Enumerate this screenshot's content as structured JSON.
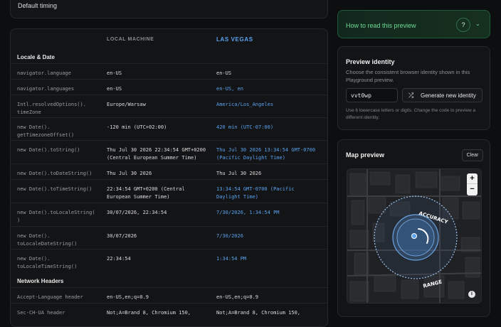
{
  "top_card": {
    "label": "Default timing"
  },
  "table": {
    "col_local": "LOCAL MACHINE",
    "col_remote": "LAS VEGAS",
    "sections": [
      {
        "title": "Locale & Date"
      },
      {
        "title": "Network Headers"
      }
    ],
    "rows": [
      {
        "key": "navigator.language",
        "local": "en-US",
        "remote": "en-US",
        "remote_highlight": false
      },
      {
        "key": "navigator.languages",
        "local": "en-US",
        "remote": "en-US, en",
        "remote_highlight": true
      },
      {
        "key": "Intl.resolvedOptions().\ntimeZone",
        "local": "Europe/Warsaw",
        "remote": "America/Los_Angeles",
        "remote_highlight": true
      },
      {
        "key": "new Date().\ngetTimezoneOffset()",
        "local": "-120 min (UTC+02:00)",
        "remote": "420 min (UTC-07:00)",
        "remote_highlight": true
      },
      {
        "key": "new Date().toString()",
        "local": "Thu Jul 30 2026 22:34:54 GMT+0200\n(Central European Summer Time)",
        "remote": "Thu Jul 30 2026 13:34:54 GMT-0700\n(Pacific Daylight Time)",
        "remote_highlight": true
      },
      {
        "key": "new Date().toDateString()",
        "local": "Thu Jul 30 2026",
        "remote": "Thu Jul 30 2026",
        "remote_highlight": false
      },
      {
        "key": "new Date().toTimeString()",
        "local": "22:34:54 GMT+0200 (Central\nEuropean Summer Time)",
        "remote": "13:34:54 GMT-0700 (Pacific\nDaylight Time)",
        "remote_highlight": true
      },
      {
        "key": "new Date().toLocaleString(\n)",
        "local": "30/07/2026, 22:34:54",
        "remote": "7/30/2026, 1:34:54 PM",
        "remote_highlight": true
      },
      {
        "key": "new Date().\ntoLocaleDateString()",
        "local": "30/07/2026",
        "remote": "7/30/2026",
        "remote_highlight": true
      },
      {
        "key": "new Date().\ntoLocaleTimeString()",
        "local": "22:34:54",
        "remote": "1:34:54 PM",
        "remote_highlight": true
      },
      {
        "key": "Accept-Language header",
        "local": "en-US,en;q=0.9",
        "remote": "en-US,en;q=0.9",
        "remote_highlight": false
      },
      {
        "key": "Sec-CH-UA header",
        "local": "Not;A=Brand 8, Chromium 150,",
        "remote": "Not;A=Brand 8, Chromium 150,",
        "remote_highlight": false
      }
    ]
  },
  "how_to": {
    "label": "How to read this preview",
    "help_icon": "question-icon",
    "chevron_icon": "chevron-down-icon"
  },
  "identity": {
    "title": "Preview identity",
    "description": "Choose the consistent browser identity shown in this Playground preview.",
    "code_value": "vvt0wp",
    "generate_label": "Generate new identity",
    "generate_icon": "shuffle-icon",
    "hint": "Use 6 lowercase letters or digits. Change the code to preview a different identity."
  },
  "map": {
    "title": "Map preview",
    "clear_label": "Clear",
    "zoom_in": "+",
    "zoom_out": "−",
    "accuracy_label": "ACCURACY",
    "range_label": "RANGE",
    "info_icon": "info-icon",
    "colors": {
      "accent": "#5aa2f0",
      "green": "#6fdc9a"
    }
  }
}
